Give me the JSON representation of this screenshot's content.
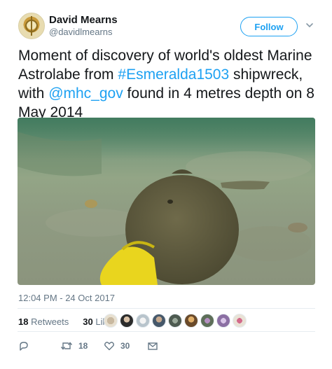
{
  "author": {
    "name": "David Mearns",
    "handle": "@davidlmearns"
  },
  "follow_label": "Follow",
  "tweet": {
    "text_1": "Moment of discovery of world's oldest Marine Astrolabe from ",
    "hashtag": "#Esmeralda1503",
    "text_2": " shipwreck, with ",
    "mention": "@mhc_gov",
    "text_3": " found in 4 metres depth on 8 May 2014"
  },
  "timestamp": "12:04 PM - 24 Oct 2017",
  "stats": {
    "retweets_count": "18",
    "retweets_label": "Retweets",
    "likes_count": "30",
    "likes_label": "Likes"
  },
  "actions": {
    "reply_count": "",
    "retweet_count": "18",
    "like_count": "30"
  },
  "colors": {
    "accent": "#1da1f2",
    "muted": "#657786",
    "text": "#14171a"
  },
  "icons": [
    "chevron-down-icon",
    "reply-icon",
    "retweet-icon",
    "heart-icon",
    "envelope-icon"
  ]
}
